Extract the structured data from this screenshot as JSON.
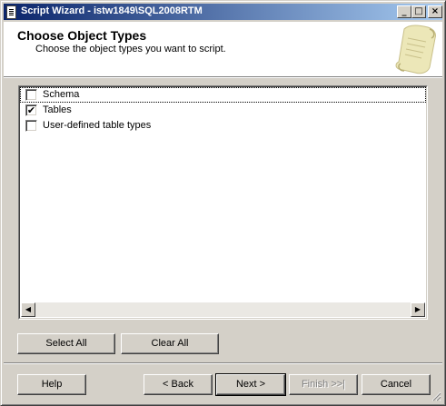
{
  "window": {
    "title": "Script Wizard - istw1849\\SQL2008RTM",
    "controls": {
      "minimize": "_",
      "maximize": "□",
      "close": "×"
    }
  },
  "header": {
    "title": "Choose Object Types",
    "subtitle": "Choose the object types you want to script."
  },
  "object_types": [
    {
      "label": "Schema",
      "checked": false,
      "mark": ""
    },
    {
      "label": "Tables",
      "checked": true,
      "mark": "✔"
    },
    {
      "label": "User-defined table types",
      "checked": false,
      "mark": ""
    }
  ],
  "scrollbar": {
    "left_arrow": "◀",
    "right_arrow": "▶"
  },
  "selection_buttons": {
    "select_all": "Select All",
    "clear_all": "Clear All"
  },
  "footer": {
    "help": "Help",
    "back": "< Back",
    "next": "Next >",
    "finish": "Finish >>|",
    "cancel": "Cancel"
  },
  "colors": {
    "titlebar_start": "#0a246a",
    "titlebar_end": "#a6caf0",
    "face": "#d4d0c8"
  }
}
